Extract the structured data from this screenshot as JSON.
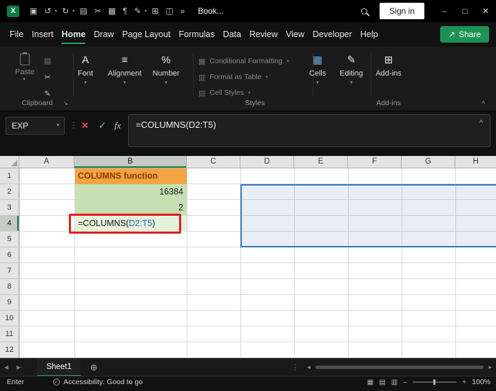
{
  "colors": {
    "excel_green": "#107C41",
    "share_green": "#1E9254",
    "tab_underline_green": "#2AA45C",
    "selection_blue": "#2E75B6",
    "orange_fill": "#F2A444",
    "orange_text": "#8A3B00",
    "green_fill": "#C6E0B4",
    "green_fill_light": "#E6F1DC",
    "annotation_red": "#E31B1B",
    "formula_ref_blue": "#2B6CC0"
  },
  "icons": {
    "excel_logo": "X",
    "dropdown_caret": "▾",
    "collapse_up": "^",
    "dialog_launcher": "↘",
    "dots_vertical": "⋮",
    "nav_left": "◀",
    "nav_right": "▶",
    "scroll_left": "◂",
    "scroll_right": "▸",
    "styles_cf": "▦",
    "styles_table": "▥",
    "styles_cell": "▤",
    "clipboard_small": "▤",
    "cut": "✂",
    "format_painter": "✎",
    "view_normal": "▦",
    "view_layout": "▤",
    "view_break": "▥",
    "share_arrow": "↗",
    "accessibility_check": "✓",
    "zoom_minus": "–",
    "zoom_plus": "+"
  },
  "titlebar": {
    "workbook_title": "Book...",
    "signin_label": "Sign in",
    "quick_access": {
      "save": "▣",
      "undo": "↺",
      "redo": "↻",
      "clipboard": "▤",
      "cut": "✂",
      "image": "▦",
      "paragraph": "¶",
      "pen": "✎",
      "table": "⊞",
      "camera": "◫",
      "overflow": "»"
    },
    "window": {
      "minimize": "–",
      "maximize": "□",
      "close": "✕"
    }
  },
  "menubar": {
    "tabs": [
      "File",
      "Insert",
      "Home",
      "Draw",
      "Page Layout",
      "Formulas",
      "Data",
      "Review",
      "View",
      "Developer",
      "Help"
    ],
    "active_tab": "Home",
    "share_label": "Share"
  },
  "ribbon": {
    "clipboard": {
      "label": "Clipboard",
      "paste_label": "Paste"
    },
    "font": {
      "label": "Font",
      "icon": "A"
    },
    "alignment": {
      "label": "Alignment",
      "icon": "≡"
    },
    "number": {
      "label": "Number",
      "icon": "%"
    },
    "styles": {
      "label": "Styles",
      "items": [
        "Conditional Formatting",
        "Format as Table",
        "Cell Styles"
      ]
    },
    "cells": {
      "label": "Cells",
      "icon": "▦"
    },
    "editing": {
      "label": "Editing",
      "icon": "✎"
    },
    "addins": {
      "label": "Add-ins",
      "button_label": "Add-ins",
      "icon": "⊞"
    }
  },
  "formula_bar": {
    "name_box": "EXP",
    "cancel": "✕",
    "enter": "✓",
    "fx": "fx",
    "formula": "=COLUMNS(D2:T5)"
  },
  "grid": {
    "column_headers": [
      "A",
      "B",
      "C",
      "D",
      "E",
      "F",
      "G",
      "H"
    ],
    "row_headers": [
      "1",
      "2",
      "3",
      "4",
      "5",
      "6",
      "7",
      "8",
      "9",
      "10",
      "11",
      "12"
    ],
    "active_cell": "B4",
    "referenced_range": "D2:T5",
    "cells": {
      "b1": "COLUMNS function",
      "b2": "16384",
      "b3": "2",
      "b4_prefix": "=COLUMNS(",
      "b4_ref": "D2:T5",
      "b4_suffix": ")"
    }
  },
  "sheet_bar": {
    "active_tab": "Sheet1",
    "add_sheet": "⊕"
  },
  "status_bar": {
    "mode": "Enter",
    "accessibility": "Accessibility: Good to go",
    "zoom": "100%"
  }
}
